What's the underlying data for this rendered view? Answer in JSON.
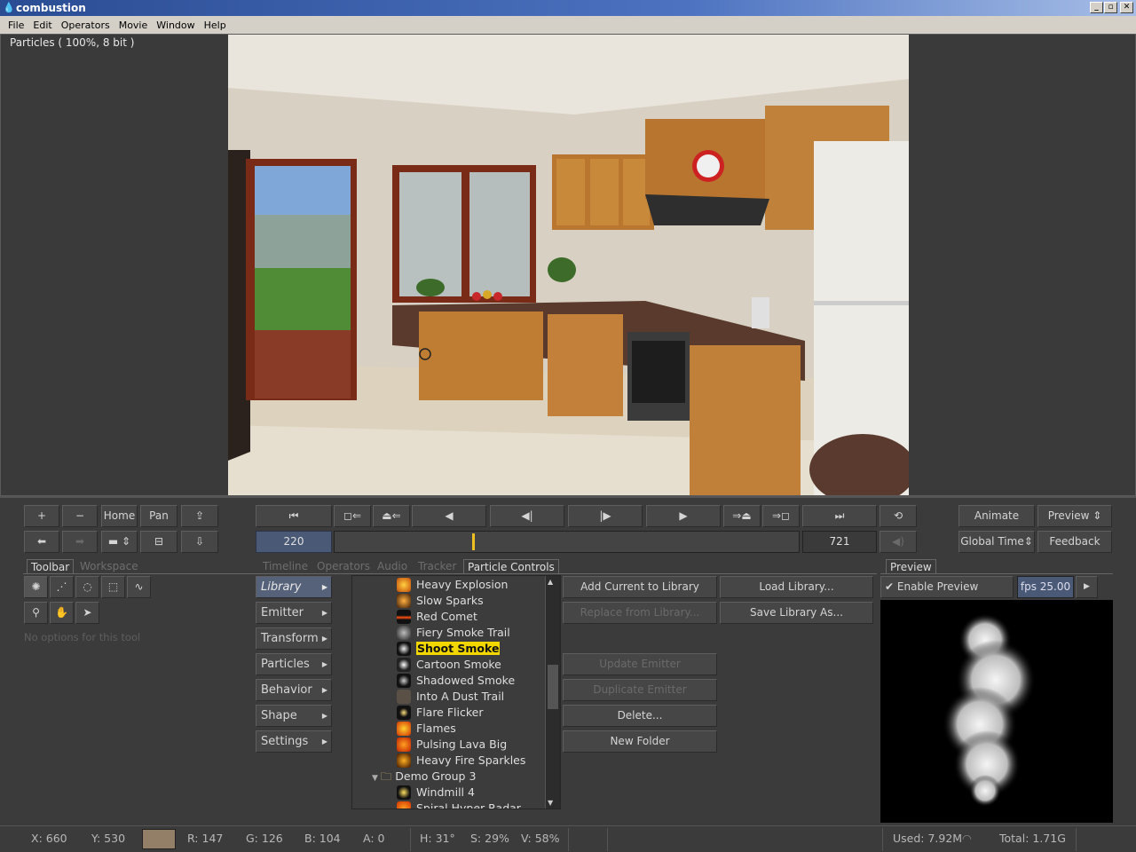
{
  "window": {
    "title": "combustion",
    "minimize": "_",
    "maximize": "▫",
    "close": "✕"
  },
  "menu": [
    "File",
    "Edit",
    "Operators",
    "Movie",
    "Window",
    "Help"
  ],
  "viewer": {
    "label": "Particles ( 100%, 8 bit )"
  },
  "view_controls": {
    "zoom_in": "+",
    "zoom_out": "−",
    "home": "Home",
    "pan": "Pan"
  },
  "timeline": {
    "current_frame": "220",
    "end_frame": "721",
    "playhead_position_fraction": 0.298
  },
  "right_controls": {
    "animate": "Animate",
    "preview": "Preview",
    "global_time": "Global Time",
    "feedback": "Feedback"
  },
  "left_tabs": {
    "toolbar": "Toolbar",
    "workspace": "Workspace",
    "no_options": "No options for this tool"
  },
  "center_tabs": [
    "Timeline",
    "Operators",
    "Audio",
    "Tracker",
    "Particle Controls"
  ],
  "sidebar": [
    "Library",
    "Emitter",
    "Transform",
    "Particles",
    "Behavior",
    "Shape",
    "Settings"
  ],
  "library_items": [
    {
      "label": "Heavy Explosion",
      "icon": "explosion-icon"
    },
    {
      "label": "Slow Sparks",
      "icon": "sparks-icon"
    },
    {
      "label": "Red Comet",
      "icon": "comet-icon"
    },
    {
      "label": "Fiery Smoke Trail",
      "icon": "smoke-trail-icon"
    },
    {
      "label": "Shoot Smoke",
      "icon": "smoke-icon"
    },
    {
      "label": "Cartoon Smoke",
      "icon": "cartoon-smoke-icon"
    },
    {
      "label": "Shadowed Smoke",
      "icon": "shadowed-smoke-icon"
    },
    {
      "label": "Into A Dust Trail",
      "icon": "dust-icon"
    },
    {
      "label": "Flare Flicker",
      "icon": "flare-icon"
    },
    {
      "label": "Flames",
      "icon": "flames-icon"
    },
    {
      "label": "Pulsing Lava Big",
      "icon": "lava-icon"
    },
    {
      "label": "Heavy Fire Sparkles",
      "icon": "fire-sparkles-icon"
    }
  ],
  "library_group": "Demo Group 3",
  "library_group_items": [
    "Windmill 4",
    "Spiral Hyper Radar"
  ],
  "selected_item": "Shoot Smoke",
  "actions": {
    "add_current": "Add Current to Library",
    "load_library": "Load Library...",
    "replace_from": "Replace from Library...",
    "save_library_as": "Save Library As...",
    "update_emitter": "Update Emitter",
    "duplicate_emitter": "Duplicate Emitter",
    "delete": "Delete...",
    "new_folder": "New Folder"
  },
  "preview": {
    "tab": "Preview",
    "enable": "Enable Preview",
    "fps": "fps 25.00"
  },
  "status": {
    "x": "X:  660",
    "y": "Y:  530",
    "r": "R: 147",
    "g": "G: 126",
    "b": "B: 104",
    "a": "A: 0",
    "h": "H: 31°",
    "s": "S: 29%",
    "v": "V: 58%",
    "swatch_color": "#937e68",
    "used": "Used: 7.92M",
    "total": "Total: 1.71G"
  }
}
